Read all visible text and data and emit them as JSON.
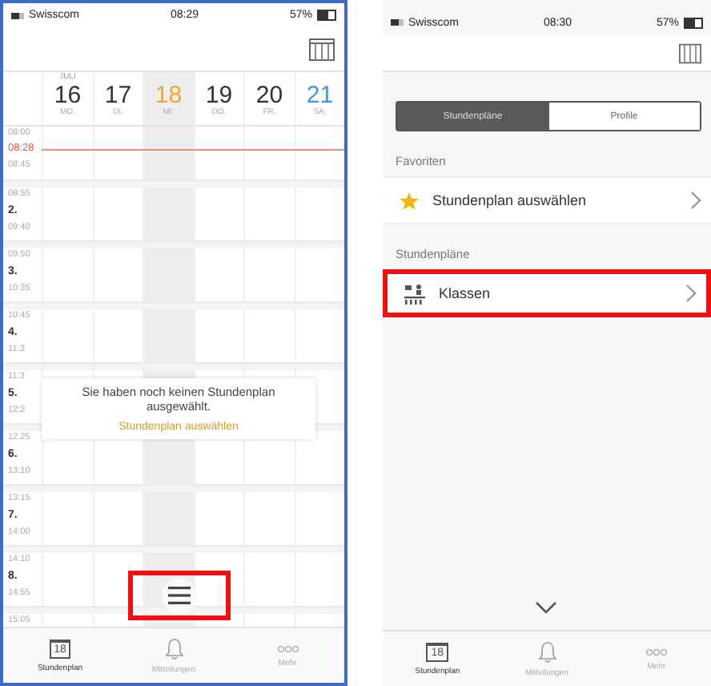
{
  "left_screen": {
    "status_bar": {
      "carrier": "Swisscom",
      "time": "08:29",
      "battery": "57%"
    },
    "month": "JULI",
    "days": [
      {
        "date": "16",
        "weekday": "MO.",
        "kind": "weekday",
        "selected": false
      },
      {
        "date": "17",
        "weekday": "DI.",
        "kind": "weekday",
        "selected": false
      },
      {
        "date": "18",
        "weekday": "MI.",
        "kind": "weekday",
        "selected": true
      },
      {
        "date": "19",
        "weekday": "DO.",
        "kind": "weekday",
        "selected": false
      },
      {
        "date": "20",
        "weekday": "FR.",
        "kind": "weekday",
        "selected": false
      },
      {
        "date": "21",
        "weekday": "SA.",
        "kind": "saturday",
        "selected": false
      }
    ],
    "periods": [
      {
        "start": "08:00",
        "current_time": "08:28",
        "end": "08:45"
      },
      {
        "start": "08:55",
        "number": "2.",
        "end": "09:40"
      },
      {
        "start": "09:50",
        "number": "3.",
        "end": "10:35"
      },
      {
        "start": "10:45",
        "number": "4.",
        "end": "11:3"
      },
      {
        "start": "11:3",
        "number": "5.",
        "end": "12:2"
      },
      {
        "start": "12:25",
        "number": "6.",
        "end": "13:10"
      },
      {
        "start": "13:15",
        "number": "7.",
        "end": "14:00"
      },
      {
        "start": "14:10",
        "number": "8.",
        "end": "14:55"
      },
      {
        "start": "15:05"
      }
    ],
    "empty_message": {
      "text": "Sie haben noch keinen Stundenplan ausgewählt.",
      "link": "Stundenplan auswählen"
    },
    "menu_button": {
      "highlighted": true
    },
    "tab_bar": [
      {
        "label": "Stundenplan",
        "badge": "18",
        "selected": true
      },
      {
        "label": "Mitteilungen",
        "selected": false
      },
      {
        "label": "Mehr",
        "selected": false
      }
    ]
  },
  "right_screen": {
    "status_bar": {
      "carrier": "Swisscom",
      "time": "08:30",
      "battery": "57%"
    },
    "segments": [
      {
        "label": "Stundenpläne",
        "selected": true
      },
      {
        "label": "Profile",
        "selected": false
      }
    ],
    "sections": [
      {
        "title": "Favoriten",
        "rows": [
          {
            "label": "Stundenplan auswählen",
            "highlighted": false
          }
        ]
      },
      {
        "title": "Stundenpläne",
        "rows": [
          {
            "label": "Klassen",
            "highlighted": true
          }
        ]
      }
    ],
    "tab_bar": [
      {
        "label": "Stundenplan",
        "badge": "18",
        "selected": true
      },
      {
        "label": "Mitteilungen",
        "selected": false
      },
      {
        "label": "Mehr",
        "selected": false
      }
    ]
  }
}
